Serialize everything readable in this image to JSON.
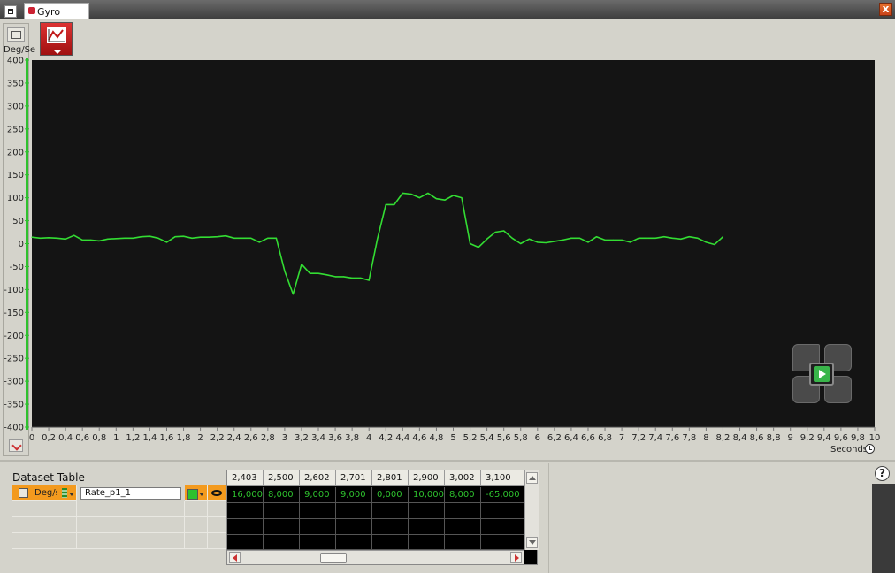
{
  "window": {
    "tab_label": "Gyro",
    "close_glyph": "x"
  },
  "y_axis": {
    "unit_label": "Deg/Se"
  },
  "x_axis": {
    "unit_label": "Seconds"
  },
  "chart_data": {
    "type": "line",
    "title": "",
    "xlabel": "Seconds",
    "ylabel": "Deg/Se",
    "xlim": [
      0,
      10
    ],
    "ylim": [
      -400,
      400
    ],
    "grid": false,
    "background": "#141414",
    "x_ticks": [
      "0",
      "0,2",
      "0,4",
      "0,6",
      "0,8",
      "1",
      "1,2",
      "1,4",
      "1,6",
      "1,8",
      "2",
      "2,2",
      "2,4",
      "2,6",
      "2,8",
      "3",
      "3,2",
      "3,4",
      "3,6",
      "3,8",
      "4",
      "4,2",
      "4,4",
      "4,6",
      "4,8",
      "5",
      "5,2",
      "5,4",
      "5,6",
      "5,8",
      "6",
      "6,2",
      "6,4",
      "6,6",
      "6,8",
      "7",
      "7,2",
      "7,4",
      "7,6",
      "7,8",
      "8",
      "8,2",
      "8,4",
      "8,6",
      "8,8",
      "9",
      "9,2",
      "9,4",
      "9,6",
      "9,8",
      "10"
    ],
    "y_ticks": [
      "400",
      "350",
      "300",
      "250",
      "200",
      "150",
      "100",
      "50",
      "0",
      "-50",
      "-100",
      "-150",
      "-200",
      "-250",
      "-300",
      "-350",
      "-400"
    ],
    "series": [
      {
        "name": "Rate_p1_1",
        "color": "#33dd33",
        "x": [
          0,
          0.1,
          0.2,
          0.3,
          0.4,
          0.5,
          0.6,
          0.7,
          0.8,
          0.9,
          1.0,
          1.1,
          1.2,
          1.3,
          1.4,
          1.5,
          1.6,
          1.7,
          1.8,
          1.9,
          2.0,
          2.1,
          2.2,
          2.3,
          2.4,
          2.5,
          2.6,
          2.7,
          2.8,
          2.9,
          3.0,
          3.1,
          3.2,
          3.3,
          3.4,
          3.5,
          3.6,
          3.7,
          3.8,
          3.9,
          4.0,
          4.1,
          4.2,
          4.3,
          4.4,
          4.5,
          4.6,
          4.7,
          4.8,
          4.9,
          5.0,
          5.1,
          5.2,
          5.3,
          5.4,
          5.5,
          5.6,
          5.7,
          5.8,
          5.9,
          6.0,
          6.1,
          6.2,
          6.3,
          6.4,
          6.5,
          6.6,
          6.7,
          6.8,
          6.9,
          7.0,
          7.1,
          7.2,
          7.3,
          7.4,
          7.5,
          7.6,
          7.7,
          7.8,
          7.9,
          8.0,
          8.1,
          8.2
        ],
        "values": [
          14,
          12,
          13,
          12,
          10,
          18,
          8,
          8,
          6,
          10,
          11,
          12,
          12,
          15,
          16,
          12,
          3,
          15,
          16,
          12,
          14,
          14,
          15,
          17,
          12,
          12,
          12,
          3,
          12,
          12,
          -60,
          -110,
          -45,
          -65,
          -65,
          -68,
          -72,
          -72,
          -75,
          -75,
          -80,
          10,
          85,
          85,
          110,
          108,
          100,
          110,
          98,
          95,
          105,
          100,
          0,
          -8,
          10,
          25,
          28,
          12,
          0,
          10,
          3,
          2,
          5,
          8,
          12,
          12,
          3,
          15,
          8,
          8,
          8,
          3,
          12,
          12,
          12,
          15,
          12,
          10,
          15,
          12,
          3,
          -2,
          15
        ]
      }
    ]
  },
  "dataset_table": {
    "title": "Dataset Table",
    "unit": "Deg/s",
    "name": "Rate_p1_1",
    "color": "#2ec12e"
  },
  "data_table": {
    "headers": [
      "2,403",
      "2,500",
      "2,602",
      "2,701",
      "2,801",
      "2,900",
      "3,002",
      "3,100"
    ],
    "values": [
      "16,000",
      "8,000",
      "9,000",
      "9,000",
      "0,000",
      "10,000",
      "8,000",
      "-65,000"
    ]
  },
  "help_glyph": "?"
}
